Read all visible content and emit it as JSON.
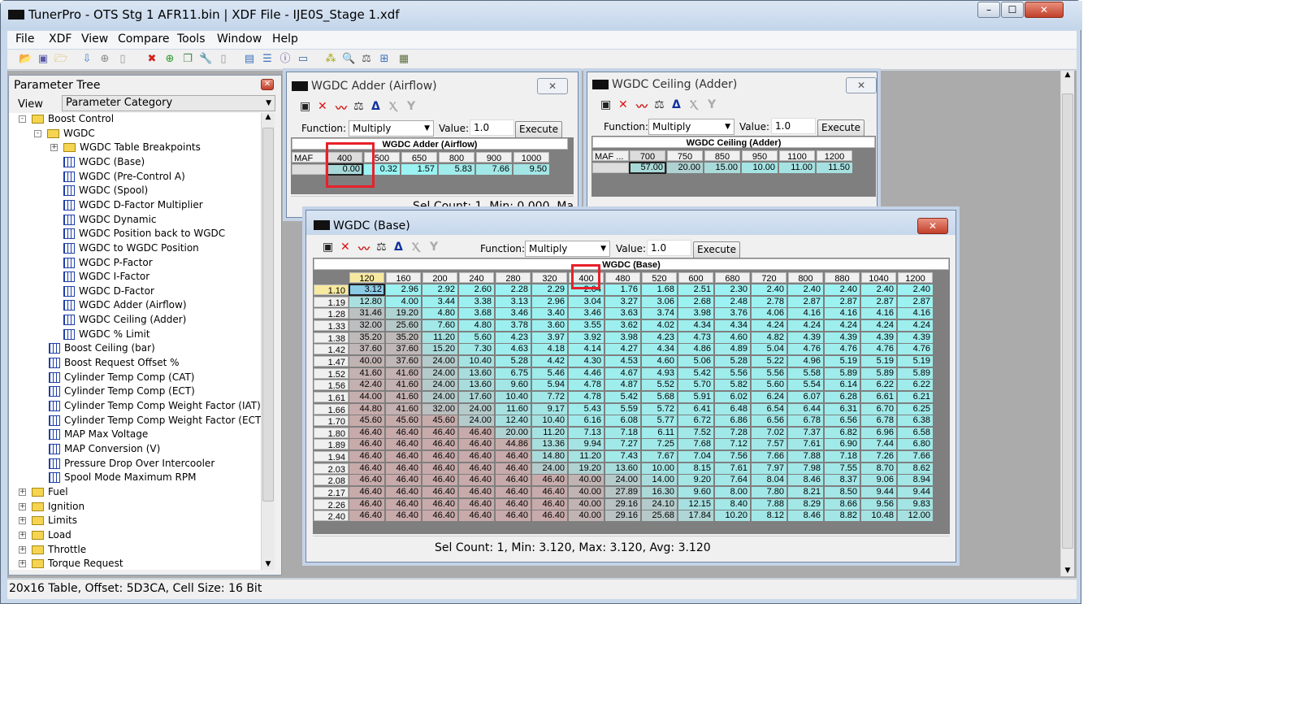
{
  "app": {
    "title": "TunerPro - OTS Stg 1 AFR11.bin | XDF File - IJE0S_Stage 1.xdf"
  },
  "menu": [
    "File",
    "XDF",
    "View",
    "Compare",
    "Tools",
    "Window",
    "Help"
  ],
  "toolbar_icons": [
    "open-icon",
    "save-icon",
    "open-folder-icon",
    "import-icon",
    "add-disk-icon",
    "new-doc-icon",
    "delete-icon",
    "add-icon",
    "copy-add-icon",
    "wrench-icon",
    "blank-doc-icon",
    "layout-icon",
    "split-icon",
    "info-window-icon",
    "monitor-icon",
    "binary-icon",
    "search-icon",
    "compare-icon",
    "hierarchy-icon",
    "calculator-icon"
  ],
  "status": "20x16 Table, Offset: 5D3CA,  Cell Size: 16 Bit",
  "tree": {
    "title": "Parameter Tree",
    "view_label": "View",
    "view_value": "Parameter Category",
    "items": [
      {
        "label": "Boost Control",
        "level": 0,
        "type": "folder",
        "expander": "-"
      },
      {
        "label": "WGDC",
        "level": 1,
        "type": "folder",
        "expander": "-"
      },
      {
        "label": "WGDC Table Breakpoints",
        "level": 2,
        "type": "folder",
        "expander": "+"
      },
      {
        "label": "WGDC (Base)",
        "level": 2,
        "type": "table"
      },
      {
        "label": "WGDC (Pre-Control A)",
        "level": 2,
        "type": "table"
      },
      {
        "label": "WGDC (Spool)",
        "level": 2,
        "type": "table"
      },
      {
        "label": "WGDC D-Factor Multiplier",
        "level": 2,
        "type": "table"
      },
      {
        "label": "WGDC Dynamic",
        "level": 2,
        "type": "table"
      },
      {
        "label": "WGDC Position back to WGDC",
        "level": 2,
        "type": "table"
      },
      {
        "label": "WGDC to WGDC Position",
        "level": 2,
        "type": "table"
      },
      {
        "label": "WGDC P-Factor",
        "level": 2,
        "type": "table"
      },
      {
        "label": "WGDC I-Factor",
        "level": 2,
        "type": "table"
      },
      {
        "label": "WGDC D-Factor",
        "level": 2,
        "type": "table"
      },
      {
        "label": "WGDC Adder (Airflow)",
        "level": 2,
        "type": "table"
      },
      {
        "label": "WGDC Ceiling (Adder)",
        "level": 2,
        "type": "table"
      },
      {
        "label": "WGDC % Limit",
        "level": 2,
        "type": "table"
      },
      {
        "label": "Boost Ceiling (bar)",
        "level": 1,
        "type": "table"
      },
      {
        "label": "Boost Request Offset %",
        "level": 1,
        "type": "table"
      },
      {
        "label": "Cylinder Temp Comp (CAT)",
        "level": 1,
        "type": "table"
      },
      {
        "label": "Cylinder Temp Comp (ECT)",
        "level": 1,
        "type": "table"
      },
      {
        "label": "Cylinder Temp Comp Weight Factor (IAT)",
        "level": 1,
        "type": "table"
      },
      {
        "label": "Cylinder Temp Comp Weight Factor (ECT)",
        "level": 1,
        "type": "table"
      },
      {
        "label": "MAP Max Voltage",
        "level": 1,
        "type": "table"
      },
      {
        "label": "MAP Conversion (V)",
        "level": 1,
        "type": "table"
      },
      {
        "label": "Pressure Drop Over Intercooler",
        "level": 1,
        "type": "table"
      },
      {
        "label": "Spool Mode Maximum RPM",
        "level": 1,
        "type": "table"
      },
      {
        "label": "Fuel",
        "level": 0,
        "type": "folder",
        "expander": "+"
      },
      {
        "label": "Ignition",
        "level": 0,
        "type": "folder",
        "expander": "+"
      },
      {
        "label": "Limits",
        "level": 0,
        "type": "folder",
        "expander": "+"
      },
      {
        "label": "Load",
        "level": 0,
        "type": "folder",
        "expander": "+"
      },
      {
        "label": "Throttle",
        "level": 0,
        "type": "folder",
        "expander": "+"
      },
      {
        "label": "Torque Request",
        "level": 0,
        "type": "folder",
        "expander": "+"
      }
    ]
  },
  "editor_common": {
    "function_label": "Function:",
    "function_value": "Multiply",
    "value_label": "Value:",
    "value": "1.0",
    "execute": "Execute"
  },
  "adder": {
    "title": "WGDC Adder (Airflow)",
    "table_title": "WGDC Adder (Airflow)",
    "row_label": "MAF R...",
    "cols": [
      "400",
      "500",
      "650",
      "800",
      "900",
      "1000"
    ],
    "values": [
      "0.00",
      "0.32",
      "1.57",
      "5.83",
      "7.66",
      "9.50"
    ],
    "status": "Sel Count: 1, Min: 0.000, Ma"
  },
  "ceiling": {
    "title": "WGDC Ceiling (Adder)",
    "table_title": "WGDC Ceiling (Adder)",
    "row_label": "MAF ...",
    "cols": [
      "700",
      "750",
      "850",
      "950",
      "1100",
      "1200"
    ],
    "values": [
      "57.00",
      "20.00",
      "15.00",
      "10.00",
      "11.00",
      "11.50"
    ]
  },
  "base": {
    "title": "WGDC (Base)",
    "table_title": "WGDC (Base)",
    "status": "Sel Count: 1, Min: 3.120, Max: 3.120, Avg: 3.120",
    "cols": [
      "120",
      "160",
      "200",
      "240",
      "280",
      "320",
      "400",
      "480",
      "520",
      "600",
      "680",
      "720",
      "800",
      "880",
      "1040",
      "1200"
    ],
    "rows": [
      "1.10",
      "1.19",
      "1.28",
      "1.33",
      "1.38",
      "1.42",
      "1.47",
      "1.52",
      "1.56",
      "1.61",
      "1.66",
      "1.70",
      "1.80",
      "1.89",
      "1.94",
      "2.03",
      "2.08",
      "2.17",
      "2.26",
      "2.40"
    ],
    "values": [
      [
        "3.12",
        "2.96",
        "2.92",
        "2.60",
        "2.28",
        "2.29",
        "2.04",
        "1.76",
        "1.68",
        "2.51",
        "2.30",
        "2.40",
        "2.40",
        "2.40",
        "2.40",
        "2.40"
      ],
      [
        "12.80",
        "4.00",
        "3.44",
        "3.38",
        "3.13",
        "2.96",
        "3.04",
        "3.27",
        "3.06",
        "2.68",
        "2.48",
        "2.78",
        "2.87",
        "2.87",
        "2.87",
        "2.87"
      ],
      [
        "31.46",
        "19.20",
        "4.80",
        "3.68",
        "3.46",
        "3.40",
        "3.46",
        "3.63",
        "3.74",
        "3.98",
        "3.76",
        "4.06",
        "4.16",
        "4.16",
        "4.16",
        "4.16"
      ],
      [
        "32.00",
        "25.60",
        "7.60",
        "4.80",
        "3.78",
        "3.60",
        "3.55",
        "3.62",
        "4.02",
        "4.34",
        "4.34",
        "4.24",
        "4.24",
        "4.24",
        "4.24",
        "4.24"
      ],
      [
        "35.20",
        "35.20",
        "11.20",
        "5.60",
        "4.23",
        "3.97",
        "3.92",
        "3.98",
        "4.23",
        "4.73",
        "4.60",
        "4.82",
        "4.39",
        "4.39",
        "4.39",
        "4.39"
      ],
      [
        "37.60",
        "37.60",
        "15.20",
        "7.30",
        "4.63",
        "4.18",
        "4.14",
        "4.27",
        "4.34",
        "4.86",
        "4.89",
        "5.04",
        "4.76",
        "4.76",
        "4.76",
        "4.76"
      ],
      [
        "40.00",
        "37.60",
        "24.00",
        "10.40",
        "5.28",
        "4.42",
        "4.30",
        "4.53",
        "4.60",
        "5.06",
        "5.28",
        "5.22",
        "4.96",
        "5.19",
        "5.19",
        "5.19"
      ],
      [
        "41.60",
        "41.60",
        "24.00",
        "13.60",
        "6.75",
        "5.46",
        "4.46",
        "4.67",
        "4.93",
        "5.42",
        "5.56",
        "5.56",
        "5.58",
        "5.89",
        "5.89",
        "5.89"
      ],
      [
        "42.40",
        "41.60",
        "24.00",
        "13.60",
        "9.60",
        "5.94",
        "4.78",
        "4.87",
        "5.52",
        "5.70",
        "5.82",
        "5.60",
        "5.54",
        "6.14",
        "6.22",
        "6.22"
      ],
      [
        "44.00",
        "41.60",
        "24.00",
        "17.60",
        "10.40",
        "7.72",
        "4.78",
        "5.42",
        "5.68",
        "5.91",
        "6.02",
        "6.24",
        "6.07",
        "6.28",
        "6.61",
        "6.21"
      ],
      [
        "44.80",
        "41.60",
        "32.00",
        "24.00",
        "11.60",
        "9.17",
        "5.43",
        "5.59",
        "5.72",
        "6.41",
        "6.48",
        "6.54",
        "6.44",
        "6.31",
        "6.70",
        "6.25"
      ],
      [
        "45.60",
        "45.60",
        "45.60",
        "24.00",
        "12.40",
        "10.40",
        "6.16",
        "6.08",
        "5.77",
        "6.72",
        "6.86",
        "6.56",
        "6.78",
        "6.56",
        "6.78",
        "6.38"
      ],
      [
        "46.40",
        "46.40",
        "46.40",
        "46.40",
        "20.00",
        "11.20",
        "7.13",
        "7.18",
        "6.11",
        "7.52",
        "7.28",
        "7.02",
        "7.37",
        "6.82",
        "6.96",
        "6.58"
      ],
      [
        "46.40",
        "46.40",
        "46.40",
        "46.40",
        "44.86",
        "13.36",
        "9.94",
        "7.27",
        "7.25",
        "7.68",
        "7.12",
        "7.57",
        "7.61",
        "6.90",
        "7.44",
        "6.80"
      ],
      [
        "46.40",
        "46.40",
        "46.40",
        "46.40",
        "46.40",
        "14.80",
        "11.20",
        "7.43",
        "7.67",
        "7.04",
        "7.56",
        "7.66",
        "7.88",
        "7.18",
        "7.26",
        "7.66"
      ],
      [
        "46.40",
        "46.40",
        "46.40",
        "46.40",
        "46.40",
        "24.00",
        "19.20",
        "13.60",
        "10.00",
        "8.15",
        "7.61",
        "7.97",
        "7.98",
        "7.55",
        "8.70",
        "8.62"
      ],
      [
        "46.40",
        "46.40",
        "46.40",
        "46.40",
        "46.40",
        "46.40",
        "40.00",
        "24.00",
        "14.00",
        "9.20",
        "7.64",
        "8.04",
        "8.46",
        "8.37",
        "9.06",
        "8.94"
      ],
      [
        "46.40",
        "46.40",
        "46.40",
        "46.40",
        "46.40",
        "46.40",
        "40.00",
        "27.89",
        "16.30",
        "9.60",
        "8.00",
        "7.80",
        "8.21",
        "8.50",
        "9.44",
        "9.44"
      ],
      [
        "46.40",
        "46.40",
        "46.40",
        "46.40",
        "46.40",
        "46.40",
        "40.00",
        "29.16",
        "24.10",
        "12.15",
        "8.40",
        "7.88",
        "8.29",
        "8.66",
        "9.56",
        "9.83"
      ],
      [
        "46.40",
        "46.40",
        "46.40",
        "46.40",
        "46.40",
        "46.40",
        "40.00",
        "29.16",
        "25.68",
        "17.84",
        "10.20",
        "8.12",
        "8.46",
        "8.82",
        "10.48",
        "12.00"
      ]
    ]
  },
  "colors": {
    "cell_low": "#99f6f6",
    "cell_mid": "#b4cccc",
    "cell_high": "#c8aaaa",
    "selected_axis": "#f7e9a0",
    "highlight": "#e8202a"
  }
}
